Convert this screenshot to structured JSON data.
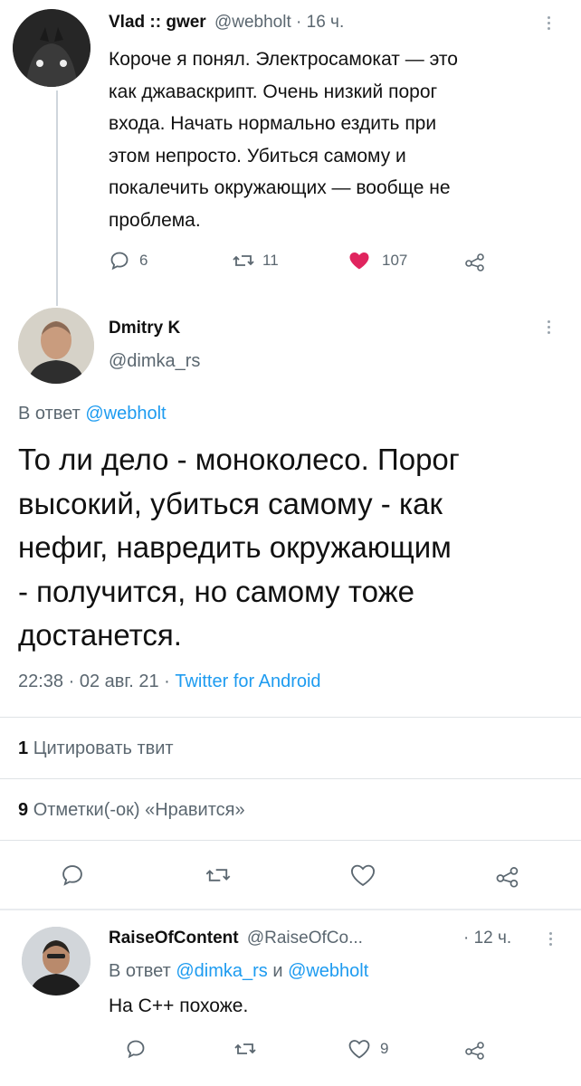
{
  "tweet1": {
    "name": "Vlad :: gwer",
    "handle": "@webholt",
    "sep": "·",
    "time": "16 ч.",
    "lines": [
      "Короче я понял. Электросамокат — это",
      "как джаваскрипт. Очень низкий порог",
      "входа. Начать нормально ездить при",
      "этом непросто. Убиться самому и",
      "покалечить окружающих — вообще не",
      "проблема."
    ],
    "replies": "6",
    "retweets": "11",
    "likes": "107"
  },
  "tweet2": {
    "name": "Dmitry K",
    "handle": "@dimka_rs",
    "reply_prefix": "В ответ",
    "reply_to": "@webholt",
    "lines": [
      "То ли дело - моноколесо. Порог",
      "высокий, убиться самому - как",
      "нефиг, навредить окружающим",
      "- получится, но самому тоже",
      "достанется."
    ],
    "meta": "22:38 · 02 авг. 21 · ",
    "source": "Twitter for Android",
    "quotes_count": "1",
    "quotes_label": "Цитировать твит",
    "likes_count": "9",
    "likes_label": "Отметки(-ок) «Нравится»"
  },
  "tweet3": {
    "name": "RaiseOfContent",
    "handle": "@RaiseOfCo...",
    "time": "· 12 ч.",
    "reply_prefix": "В ответ",
    "reply_to_1": "@dimka_rs",
    "and": "и",
    "reply_to_2": "@webholt",
    "text": "На С++ похоже.",
    "likes": "9"
  },
  "colors": {
    "link": "#1d9bf0",
    "like_active": "#e0245e",
    "secondary": "#5b6770"
  },
  "icons": [
    "reply-icon",
    "retweet-icon",
    "like-icon",
    "share-icon",
    "more-icon"
  ]
}
